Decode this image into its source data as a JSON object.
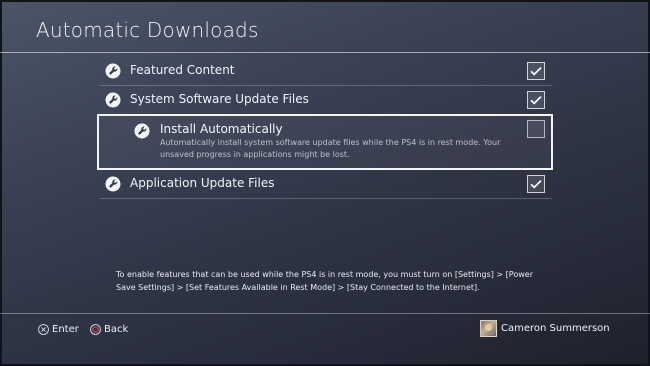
{
  "page": {
    "title": "Automatic Downloads"
  },
  "settings": [
    {
      "label": "Featured Content",
      "checked": true,
      "icon": "wrench-icon"
    },
    {
      "label": "System Software Update Files",
      "checked": true,
      "icon": "wrench-icon"
    },
    {
      "label": "Application Update Files",
      "checked": true,
      "icon": "wrench-icon"
    }
  ],
  "selected_setting": {
    "label": "Install Automatically",
    "description": "Automatically install system software update files while the PS4 is in rest mode. Your unsaved progress in applications might be lost.",
    "checked": false,
    "icon": "wrench-icon"
  },
  "footer": {
    "note": "To enable features that can be used while the PS4 is in rest mode, you must turn on [Settings] > [Power Save Settings] > [Set Features Available in Rest Mode] > [Stay Connected to the Internet]."
  },
  "nav": {
    "enter_label": "Enter",
    "enter_icon": "cross-button-icon",
    "back_label": "Back",
    "back_icon": "circle-button-icon"
  },
  "user": {
    "name": "Cameron Summerson"
  },
  "colors": {
    "background": "#303546",
    "text": "#f2f4f6",
    "circle_button": "#e0453c"
  }
}
